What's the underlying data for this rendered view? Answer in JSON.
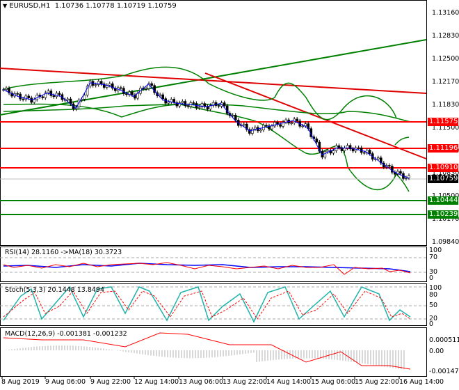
{
  "header": {
    "symbol": "EURUSD,H1",
    "open": "1.10736",
    "high": "1.10778",
    "low": "1.10719",
    "close": "1.10759"
  },
  "price_axis": [
    "1.13160",
    "1.12830",
    "1.12500",
    "1.12170",
    "1.11830",
    "1.11500",
    "1.11170",
    "1.10830",
    "1.10500",
    "1.10170",
    "1.09840"
  ],
  "levels": [
    {
      "value": "1.11575",
      "color": "#ff0000"
    },
    {
      "value": "1.11196",
      "color": "#ff0000"
    },
    {
      "value": "1.10910",
      "color": "#ff0000"
    },
    {
      "value": "1.10759",
      "color": "#000000"
    },
    {
      "value": "1.10444",
      "color": "#008000"
    },
    {
      "value": "1.10239",
      "color": "#008000"
    }
  ],
  "rsi": {
    "title": "RSI(14) 28.1160  ->MA(18) 30.3723",
    "axis": [
      "100",
      "70",
      "30",
      "0"
    ]
  },
  "stoch": {
    "title": "Stoch(5,3,3) 20.1448 13.8494",
    "axis": [
      "100",
      "80",
      "50",
      "20",
      "0"
    ]
  },
  "macd": {
    "title": "MACD(12,26,9) -0.001381 -0.001232",
    "axis": [
      "0.000511",
      "0.00",
      "-0.001471"
    ]
  },
  "time_axis": [
    "8 Aug 2019",
    "9 Aug 06:00",
    "9 Aug 22:00",
    "12 Aug 14:00",
    "13 Aug 06:00",
    "13 Aug 22:00",
    "14 Aug 14:00",
    "15 Aug 06:00",
    "15 Aug 22:00",
    "16 Aug 14:00"
  ],
  "chart_data": {
    "type": "line",
    "title": "EURUSD,H1",
    "ylim": [
      1.0984,
      1.1316
    ],
    "x": [
      0,
      1,
      2,
      3,
      4,
      5,
      6,
      7,
      8,
      9,
      10,
      11,
      12,
      13,
      14,
      15,
      16,
      17,
      18,
      19,
      20,
      21,
      22,
      23,
      24,
      25,
      26,
      27,
      28
    ],
    "values": [
      1.1205,
      1.1195,
      1.119,
      1.12,
      1.1195,
      1.1178,
      1.1215,
      1.1212,
      1.1205,
      1.1195,
      1.1213,
      1.119,
      1.1185,
      1.1183,
      1.118,
      1.1185,
      1.116,
      1.1145,
      1.115,
      1.1155,
      1.116,
      1.115,
      1.111,
      1.112,
      1.112,
      1.1115,
      1.11,
      1.1085,
      1.1076
    ]
  }
}
